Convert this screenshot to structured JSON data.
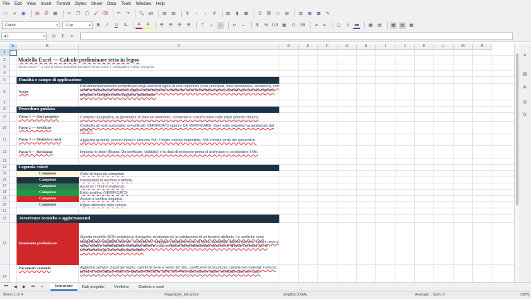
{
  "menu": [
    "File",
    "Edit",
    "View",
    "Insert",
    "Format",
    "Styles",
    "Sheet",
    "Data",
    "Tools",
    "Window",
    "Help"
  ],
  "toolbar": {
    "font_name": "Calibri",
    "font_size": "11 pt"
  },
  "formula": {
    "cell_ref": "A1",
    "fx": "fx",
    "sigma": "Σ",
    "equals": "="
  },
  "columns": [
    {
      "name": "A",
      "sel": true
    },
    {
      "name": "B"
    },
    {
      "name": "C"
    },
    {
      "name": "D"
    },
    {
      "name": "E"
    },
    {
      "name": "F"
    },
    {
      "name": "G"
    },
    {
      "name": "H"
    },
    {
      "name": "I"
    },
    {
      "name": "J"
    },
    {
      "name": "K"
    },
    {
      "name": "L"
    },
    {
      "name": "M"
    },
    {
      "name": "N"
    }
  ],
  "rows": [
    "1",
    "2",
    "3",
    "4",
    "5",
    "6",
    "7",
    "8",
    "9",
    "10",
    "11",
    "12",
    "13",
    "14",
    "15",
    "16",
    "17",
    "18",
    "19",
    "20",
    "21",
    "22",
    "23",
    "24"
  ],
  "sheet": {
    "title": "Modello Excel — Calcolo preliminare tetto in legno",
    "subtitle": "Master Excel — a cura di Marco Mandiatti Senatore senior Excel e sviluppatore Python (Spagna)",
    "sec_purpose": "Finalità e campo di applicazione",
    "scope_label": "Scopo",
    "scope_text": "Pre-dimensionamento semplificato degli elementi lignei di una copertura (travi principali, travi secondarie, arcarecci), con verifica indicativa di flessione, taglio e deformazione e stima dei costi di fornitura e posa. Pensato per piccole imprese, artigiani e famiglie come supporto preliminare.",
    "sec_guide": "Procedura guidata",
    "steps": [
      {
        "label": "Passo 1 — Dati progetto",
        "text": "Compila l'anagrafica, la geometria di ciascun elemento, i materiali e i carichi nelle celle input (sfondo chiaro)."
      },
      {
        "label": "Passo 2 — Verifiche",
        "text": "Controlla gli esiti automatici semplificati: VERIFICATO oppure DA VERIFICARE. Ogni esito negativo va analizzato dal tecnico."
      },
      {
        "label": "Passo 3 — Distinta e costi",
        "text": "Aggiorna quantità, prezzi unitari e aliquota IVA: il foglio calcola imponibile, IVA e totale lordo del preventivo."
      },
      {
        "label": "Passo 4 — Revisione",
        "text": "Imposta lo stato (Bozza, Da verificare, Validato) e la data di revisione prima di archiviare o condividere il file."
      }
    ],
    "sec_legend": "Legenda colori",
    "legend": [
      {
        "swatch": "Campione",
        "bg": "#fff7d6",
        "fg": "#1f3244",
        "text": "Celle di input da compilare"
      },
      {
        "swatch": "Campione",
        "bg": "#1f3244",
        "fg": "#ffffff",
        "text": "Intestazioni di sezione e tabella"
      },
      {
        "swatch": "Campione",
        "bg": "#2e7a52",
        "fg": "#ffffff",
        "text": "Accento / Titoli in evidenza"
      },
      {
        "swatch": "Campione",
        "bg": "#1d9b45",
        "fg": "#ffffff",
        "text": "Esito positivo (VERIFICATO)"
      },
      {
        "swatch": "Campione",
        "bg": "#d0282a",
        "fg": "#ffffff",
        "text": "Avviso o verifica negativa"
      },
      {
        "swatch": "Campione",
        "bg": "#eef2f7",
        "fg": "#1f3244",
        "text": "Righe alternate delle tabelle"
      }
    ],
    "sec_notes": "Avvertenze tecniche e aggiornamenti",
    "tool_label": "Strumento preliminare",
    "tool_text": "Questo modello NON sostituisce il progetto strutturale né la validazione di un tecnico abilitato. Le verifiche sono semplificate: instabilità laterale, connessioni, appoggi, comportamento al fuoco, durabilità, azione sismica, carichi neve e vento locali e combinazioni normative devono essere valutati dal professionista secondo le Norme Tecniche per le Costruzioni e gli Eurocodici applicabili.",
    "params_label": "Parametri variabili",
    "params_text": "Aggiorna sempre classi del legno, carichi di neve e vento del sito, coefficienti di sicurezza, tabelle dei materiali e prezzi prima di ogni utilizzo reale. Le aliquote IVA (22%, 10%, 5%, 4% e altro valore) vanno verificate caso per caso."
  },
  "tabs": [
    {
      "label": "Istruzioni",
      "active": true
    },
    {
      "label": "Dati progetto"
    },
    {
      "label": "Verifiche"
    },
    {
      "label": "Distinta e costi"
    }
  ],
  "status": {
    "sheet": "Sheet 1 of 4",
    "style": "PageStyle_Istruzioni",
    "lang": "English (USA)",
    "calc": "Average: ; Sum: 0",
    "zoom": "100%"
  }
}
